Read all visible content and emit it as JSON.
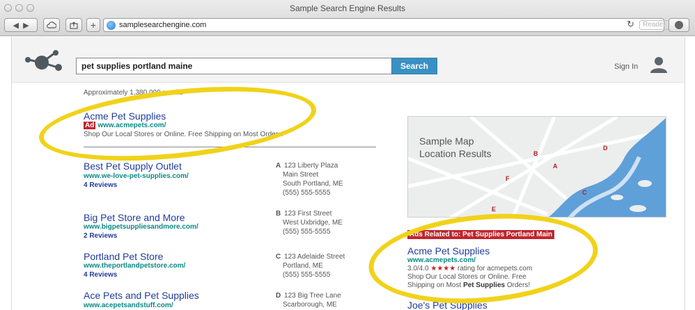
{
  "window": {
    "title": "Sample Search Engine Results",
    "url": "samplesearchengine.com",
    "reader_label": "Reader"
  },
  "search": {
    "query": "pet supplies portland maine",
    "button_label": "Search",
    "sign_in": "Sign In"
  },
  "results_count": "Approximately 1,380,000 results",
  "top_ad": {
    "badge": "Ad",
    "title": "Acme Pet Supplies",
    "url": "www.acmepets.com/",
    "description": "Shop Our Local Stores or Online. Free Shipping on Most Orders!"
  },
  "results": [
    {
      "title": "Best Pet Supply Outlet",
      "url": "www.we-love-pet-supplies.com/",
      "reviews": "4 Reviews",
      "letter": "A",
      "address": [
        "123 Liberty Plaza",
        "Main Street",
        "South Portland, ME",
        "(555) 555-5555"
      ]
    },
    {
      "title": "Big Pet Store and More",
      "url": "www.bigpetsuppliesandmore.com/",
      "reviews": "2 Reviews",
      "letter": "B",
      "address": [
        "123 First Street",
        "West Uxbridge, ME",
        "(555) 555-5555"
      ]
    },
    {
      "title": "Portland Pet Store",
      "url": "www.theportlandpetstore.com/",
      "reviews": "4 Reviews",
      "letter": "C",
      "address": [
        "123 Adelaide Street",
        "Portland, ME",
        "(555) 555-5555"
      ]
    },
    {
      "title": "Ace Pets and Pet Supplies",
      "url": "www.acepetsandstuff.com/",
      "reviews": "",
      "letter": "D",
      "address": [
        "123 Big Tree Lane",
        "Scarborough, ME"
      ]
    }
  ],
  "map": {
    "title_line1": "Sample Map",
    "title_line2": "Location Results",
    "pins": [
      "A",
      "B",
      "C",
      "D",
      "E",
      "F"
    ]
  },
  "side_ads": {
    "header": "Ads Related to: Pet Supplies Portland Main",
    "ad1": {
      "title": "Acme Pet Supplies",
      "url": "www.acmepets.com/",
      "rating_prefix": "3.0/4.0",
      "stars": "★★★★",
      "rating_suffix": "rating for acmepets.com",
      "desc_line1": "Shop Our Local Stores or Online. Free",
      "desc_line2_pre": "Shipping on Most ",
      "desc_line2_bold": "Pet Supplies",
      "desc_line2_post": " Orders!"
    },
    "ad2": {
      "title": "Joe's Pet Supplies"
    }
  },
  "colors": {
    "accent": "#3a90c3",
    "ad_red": "#c0262d",
    "link": "#1f3c9e",
    "url_teal": "#0a8a85",
    "highlight": "#f1d21a"
  }
}
